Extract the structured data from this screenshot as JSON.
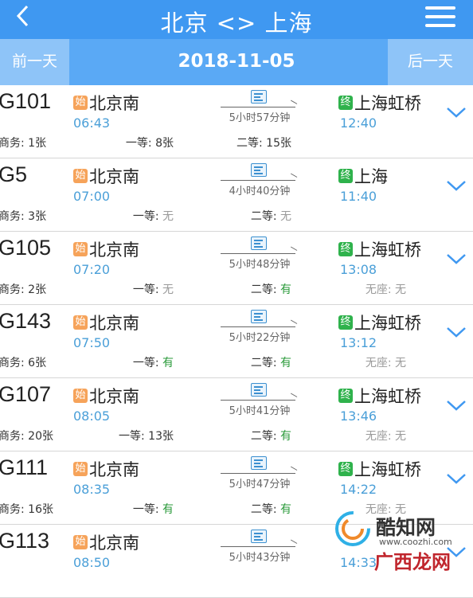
{
  "header": {
    "title": "北京 <> 上海",
    "back_icon": "chevron-left-icon",
    "menu_icon": "menu-icon",
    "bg_color": "#3f98f1"
  },
  "date_nav": {
    "prev_label": "前一天",
    "date": "2018-11-05",
    "next_label": "后一天"
  },
  "trains": [
    {
      "no": "G101",
      "from_badge": "始",
      "from": "北京南",
      "dep": "06:43",
      "duration": "5小时57分钟",
      "to_badge": "终",
      "to": "上海虹桥",
      "arr": "12:40",
      "s1": "商务: 1张",
      "s2_label": "一等: ",
      "s2_val": "8张",
      "s3_label": "二等: ",
      "s3_val": "15张",
      "s4": ""
    },
    {
      "no": "G5",
      "from_badge": "始",
      "from": "北京南",
      "dep": "07:00",
      "duration": "4小时40分钟",
      "to_badge": "终",
      "to": "上海",
      "arr": "11:40",
      "s1": "商务: 3张",
      "s2_label": "一等: ",
      "s2_val": "无",
      "s3_label": "二等: ",
      "s3_val": "无",
      "s4": ""
    },
    {
      "no": "G105",
      "from_badge": "始",
      "from": "北京南",
      "dep": "07:20",
      "duration": "5小时48分钟",
      "to_badge": "终",
      "to": "上海虹桥",
      "arr": "13:08",
      "s1": "商务: 2张",
      "s2_label": "一等: ",
      "s2_val": "无",
      "s3_label": "二等: ",
      "s3_val": "有",
      "s4": "无座: 无"
    },
    {
      "no": "G143",
      "from_badge": "始",
      "from": "北京南",
      "dep": "07:50",
      "duration": "5小时22分钟",
      "to_badge": "终",
      "to": "上海虹桥",
      "arr": "13:12",
      "s1": "商务: 6张",
      "s2_label": "一等: ",
      "s2_val": "有",
      "s3_label": "二等: ",
      "s3_val": "有",
      "s4": "无座: 无"
    },
    {
      "no": "G107",
      "from_badge": "始",
      "from": "北京南",
      "dep": "08:05",
      "duration": "5小时41分钟",
      "to_badge": "终",
      "to": "上海虹桥",
      "arr": "13:46",
      "s1": "商务: 20张",
      "s2_label": "一等: ",
      "s2_val": "13张",
      "s3_label": "二等: ",
      "s3_val": "有",
      "s4": "无座: 无"
    },
    {
      "no": "G111",
      "from_badge": "始",
      "from": "北京南",
      "dep": "08:35",
      "duration": "5小时47分钟",
      "to_badge": "终",
      "to": "上海虹桥",
      "arr": "14:22",
      "s1": "商务: 16张",
      "s2_label": "一等: ",
      "s2_val": "有",
      "s3_label": "二等: ",
      "s3_val": "有",
      "s4": "无座: 无"
    },
    {
      "no": "G113",
      "from_badge": "始",
      "from": "北京南",
      "dep": "08:50",
      "duration": "5小时43分钟",
      "to_badge": "",
      "to": "",
      "arr": "14:33",
      "s1": "",
      "s2_label": "",
      "s2_val": "",
      "s3_label": "",
      "s3_val": "",
      "s4": ""
    }
  ],
  "watermark": {
    "name": "酷知网",
    "url": "www.coozhi.com",
    "site": "广西龙网"
  },
  "colors": {
    "time": "#4a9fd8",
    "available": "#2a9a3a",
    "start_badge": "#f6a35a",
    "end_badge": "#2fb24c"
  }
}
